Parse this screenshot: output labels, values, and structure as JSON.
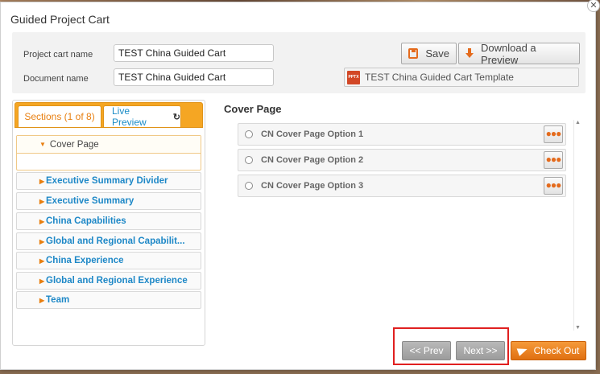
{
  "dialog": {
    "title": "Guided Project Cart",
    "close_glyph": "✕"
  },
  "form": {
    "cart_name_label": "Project cart name",
    "cart_name_value": "TEST China Guided Cart",
    "document_name_label": "Document name",
    "document_name_value": "TEST China Guided Cart",
    "save_label": "Save",
    "download_label": "Download a Preview",
    "template_icon_text": "PPTX",
    "template_name": "TEST China Guided Cart Template"
  },
  "tabs": {
    "sections_label": "Sections (1 of 8)",
    "live_preview_label": "Live Preview",
    "refresh_glyph": "↻"
  },
  "sections": {
    "open": {
      "label": "Cover Page"
    },
    "items": [
      {
        "label": "Executive Summary Divider"
      },
      {
        "label": "Executive Summary"
      },
      {
        "label": "China Capabilities"
      },
      {
        "label": "Global and Regional Capabilit..."
      },
      {
        "label": "China Experience"
      },
      {
        "label": "Global and Regional Experience"
      },
      {
        "label": "Team"
      }
    ]
  },
  "right": {
    "title": "Cover Page",
    "options": [
      {
        "label": "CN Cover Page Option 1"
      },
      {
        "label": "CN Cover Page Option 2"
      },
      {
        "label": "CN Cover Page Option 3"
      }
    ],
    "more_glyph": "●●●"
  },
  "footer": {
    "prev_label": "<< Prev",
    "next_label": "Next >>",
    "checkout_label": "Check Out"
  },
  "colors": {
    "accent_orange": "#f5a623",
    "link_blue": "#1e88c7",
    "checkout_orange": "#e07012",
    "highlight_red": "#e02020"
  }
}
